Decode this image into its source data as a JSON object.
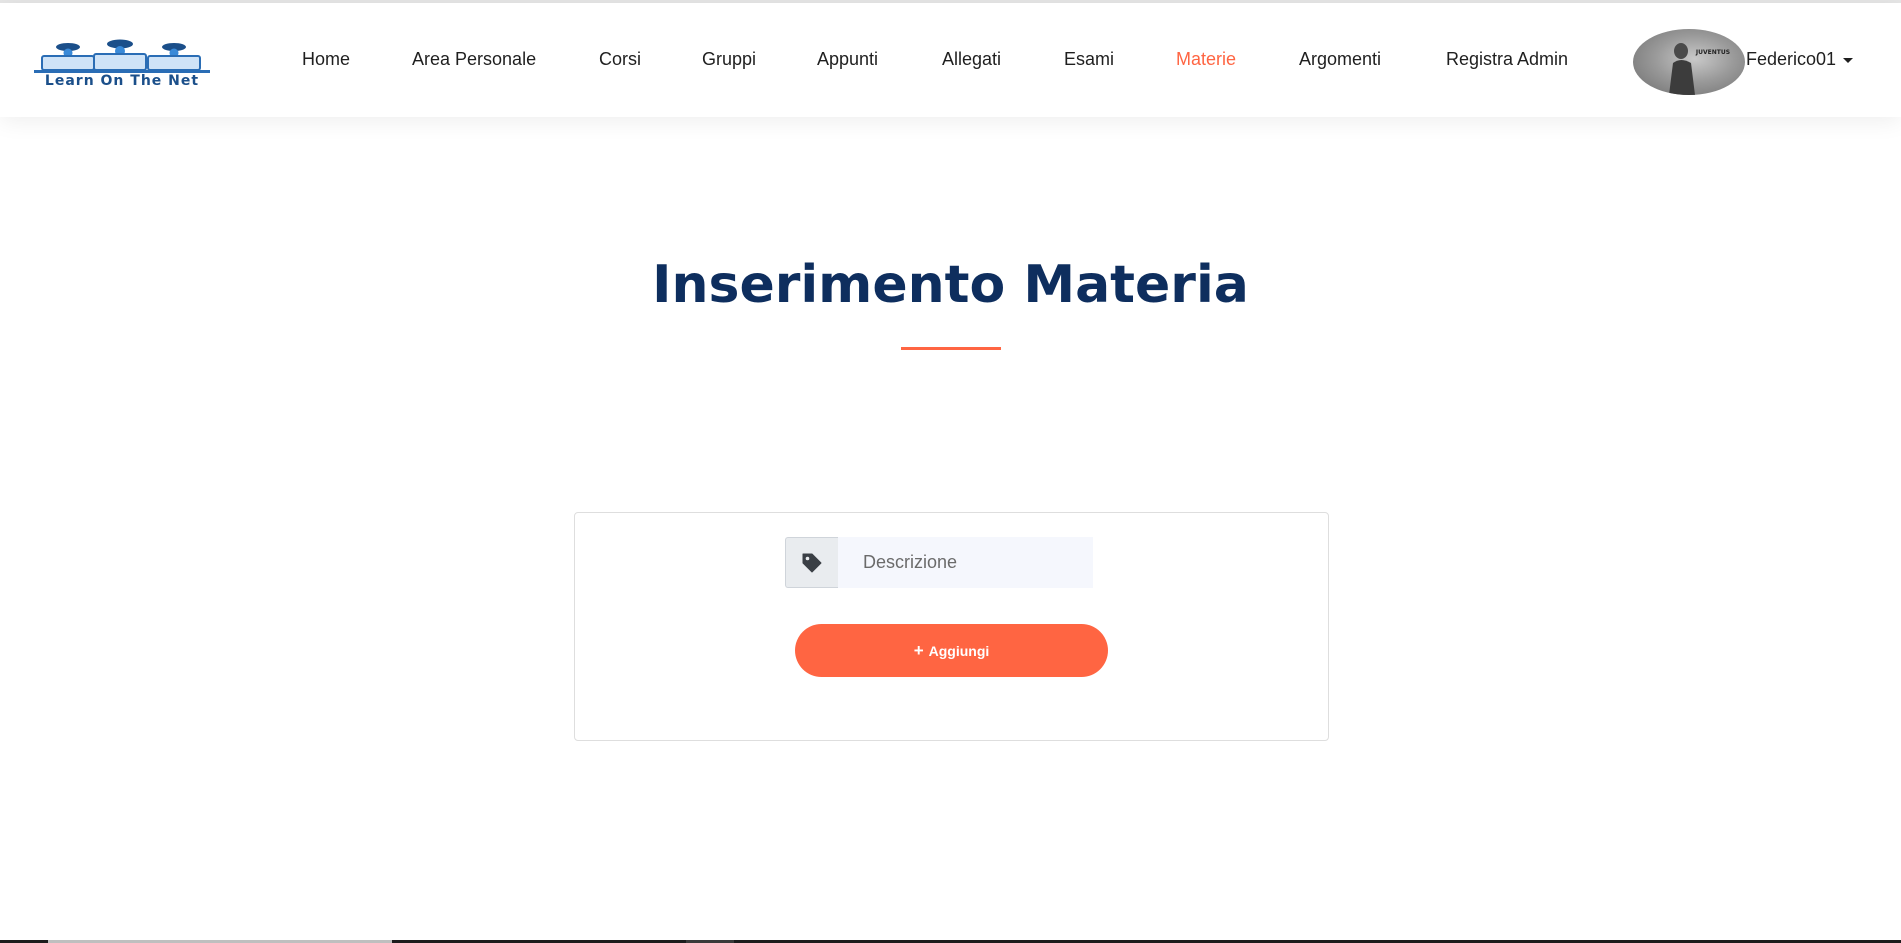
{
  "brand": {
    "logo_text": "Learn On The Net"
  },
  "nav": {
    "items": [
      {
        "label": "Home",
        "active": false
      },
      {
        "label": "Area Personale",
        "active": false
      },
      {
        "label": "Corsi",
        "active": false
      },
      {
        "label": "Gruppi",
        "active": false
      },
      {
        "label": "Appunti",
        "active": false
      },
      {
        "label": "Allegati",
        "active": false
      },
      {
        "label": "Esami",
        "active": false
      },
      {
        "label": "Materie",
        "active": true
      },
      {
        "label": "Argomenti",
        "active": false
      },
      {
        "label": "Registra Admin",
        "active": false
      }
    ],
    "active_color": "#ff6542"
  },
  "user": {
    "name": "Federico01",
    "avatar_text": "JUVENTUS"
  },
  "main": {
    "title": "Inserimento Materia",
    "form": {
      "description_placeholder": "Descrizione",
      "description_value": "",
      "tag_icon": "tag-icon",
      "add_button_label": "Aggiungi",
      "add_button_icon": "plus-icon"
    }
  },
  "colors": {
    "title": "#0e2e5e",
    "accent": "#ff6542"
  }
}
